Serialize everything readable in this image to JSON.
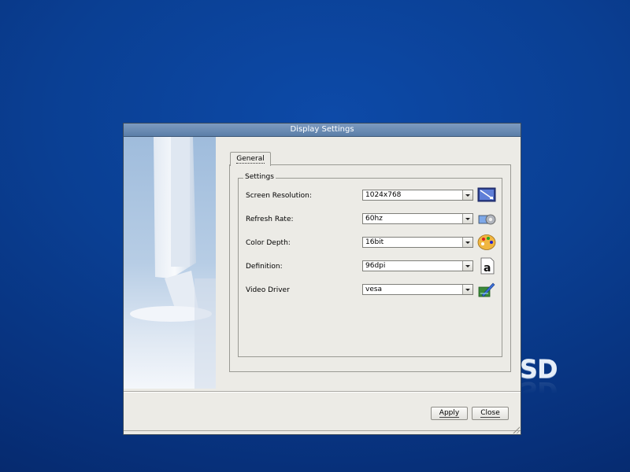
{
  "desktop": {
    "logo_text": "SD"
  },
  "window": {
    "title": "Display Settings"
  },
  "tabs": [
    {
      "label": "General"
    }
  ],
  "group": {
    "title": "Settings"
  },
  "rows": [
    {
      "label": "Screen Resolution:",
      "value": "1024x768",
      "icon": "monitor-icon"
    },
    {
      "label": "Refresh Rate:",
      "value": "60hz",
      "icon": "refresh-gear-icon"
    },
    {
      "label": "Color Depth:",
      "value": "16bit",
      "icon": "palette-icon"
    },
    {
      "label": "Definition:",
      "value": "96dpi",
      "icon": "font-letter-icon"
    },
    {
      "label": "Video Driver",
      "value": "vesa",
      "icon": "driver-pencil-icon"
    }
  ],
  "buttons": {
    "apply": "Apply",
    "close": "Close"
  },
  "colors": {
    "desktop": "#0a3f93",
    "titlebar": "#6a8cb5",
    "window_bg": "#ecebe6"
  }
}
